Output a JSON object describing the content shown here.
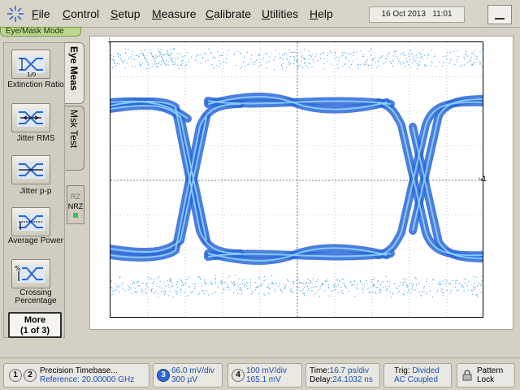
{
  "menubar": {
    "items": [
      {
        "key": "F",
        "rest": "ile"
      },
      {
        "key": "C",
        "rest": "ontrol"
      },
      {
        "key": "S",
        "rest": "etup"
      },
      {
        "key": "M",
        "rest": "easure"
      },
      {
        "key": "C",
        "rest": "alibrate"
      },
      {
        "key": "U",
        "rest": "tilities"
      },
      {
        "key": "H",
        "rest": "elp"
      }
    ],
    "date": "16 Oct 2013",
    "time": "11:01"
  },
  "mode_tab": "Eye/Mask Mode",
  "left_panel": {
    "buttons": [
      {
        "label": "Extinction Ratio",
        "icon": "extinction-ratio-icon"
      },
      {
        "label": "Jitter RMS",
        "icon": "jitter-rms-icon"
      },
      {
        "label": "Jitter p-p",
        "icon": "jitter-pp-icon"
      },
      {
        "label": "Average Power",
        "icon": "average-power-icon"
      },
      {
        "label": "Crossing Percentage",
        "icon": "crossing-percentage-icon"
      }
    ],
    "more": {
      "line1": "More",
      "line2": "(1 of 3)"
    }
  },
  "tabs": {
    "eye_meas": "Eye Meas",
    "msk_test": "Msk Test"
  },
  "rz_toggle": {
    "rz": "RZ",
    "nrz": "NRZ"
  },
  "display": {
    "marker_right": "1",
    "trace_color": "#2a68d8",
    "trace_core_color": "#8fd0ff",
    "graticule_color": "#9a9a9a"
  },
  "status": {
    "timebase_line1": "Precision Timebase...",
    "timebase_line2": "Reference: 20.00000 GHz",
    "ch1": "1",
    "ch2": "2",
    "ch3": "3",
    "ch3_line1": "66.0 mV/div",
    "ch3_line2": "300 µV",
    "ch4": "4",
    "ch4_line1": "100 mV/div",
    "ch4_line2": "165.1 mV",
    "time_label": "Time:",
    "time_value": "16.7 ps/div",
    "delay_label": "Delay:",
    "delay_value": "24.1032 ns",
    "trig_label": "Trig:",
    "trig_value": "Divided",
    "trig_line2": "AC Coupled",
    "pattern_line1": "Pattern",
    "pattern_line2": "Lock"
  }
}
